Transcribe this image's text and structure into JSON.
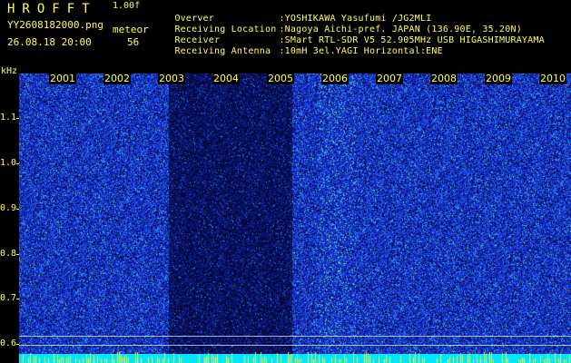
{
  "header": {
    "app_title": "HROFFT",
    "version": "1.00f",
    "filename": "YY2608182000.png",
    "datetime": "26.08.18 20:00",
    "detector_label": "meteor",
    "meteor_count": "56"
  },
  "station_info": [
    {
      "label": "Overver",
      "value": ":YOSHIKAWA Yasufumi /JG2MLI"
    },
    {
      "label": "Receiving Location",
      "value": ":Nagoya Aichi-pref. JAPAN (136.90E, 35.20N)"
    },
    {
      "label": "Receiver",
      "value": ":SMart RTL-SDR V5 52.905MHz USB HIGASHIMURAYAMA"
    },
    {
      "label": "Receiving Antenna",
      "value": ":10mH 3el.YAGI Horizontal:ENE"
    }
  ],
  "axis": {
    "y_unit": "kHz",
    "y_ticks": [
      "1.1",
      "1.0",
      "0.9",
      "0.8",
      "0.7",
      "0.6"
    ],
    "x_minutes": [
      "2001",
      "2002",
      "2003",
      "2004",
      "2005",
      "2006",
      "2007",
      "2008",
      "2009",
      "2010"
    ]
  },
  "colors": {
    "text": "#ffff55",
    "background_signal": "#1a2fb8",
    "dim_segment": "#0a1066",
    "noise_band": "#00e6ff"
  },
  "chart_data": {
    "type": "heatmap",
    "title": "",
    "xlabel": "",
    "ylabel": "kHz",
    "x_ticks": [
      "2001",
      "2002",
      "2003",
      "2004",
      "2005",
      "2006",
      "2007",
      "2008",
      "2009",
      "2010"
    ],
    "y_ticks": [
      1.1,
      1.0,
      0.9,
      0.8,
      0.7,
      0.6
    ],
    "ylim": [
      0.58,
      1.2
    ]
  }
}
